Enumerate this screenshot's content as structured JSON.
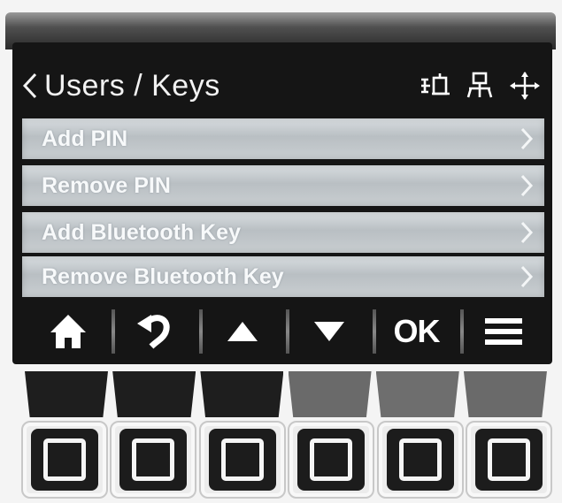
{
  "header": {
    "title": "Users / Keys",
    "icons": [
      "user-bracket-icon",
      "network-icon",
      "move-arrows-icon"
    ]
  },
  "menu": {
    "items": [
      {
        "label": "Add PIN"
      },
      {
        "label": "Remove PIN"
      },
      {
        "label": "Add Bluetooth Key"
      },
      {
        "label": "Remove Bluetooth Key"
      }
    ]
  },
  "toolbar": {
    "buttons": [
      "home-icon",
      "return-icon",
      "up-arrow-icon",
      "down-arrow-icon",
      "ok",
      "hamburger-icon"
    ],
    "ok_label": "OK"
  },
  "leds": {
    "colors": [
      "#1e1e1e",
      "#1e1e1e",
      "#1e1e1e",
      "#6a6a6a",
      "#6e6e6e",
      "#6a6a6a"
    ]
  },
  "keys": {
    "count": 6
  }
}
